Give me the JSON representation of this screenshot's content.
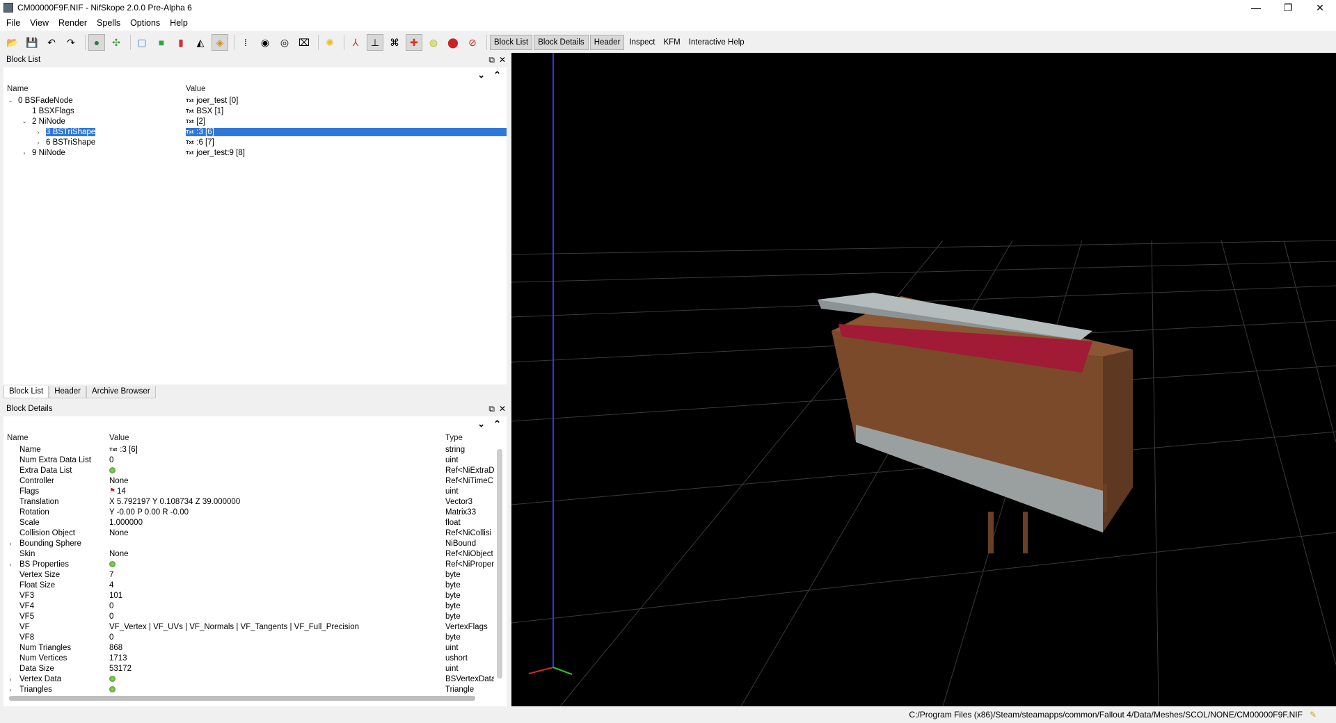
{
  "window": {
    "title": "CM00000F9F.NIF - NifSkope 2.0.0 Pre-Alpha 6",
    "controls": [
      "—",
      "❐",
      "✕"
    ]
  },
  "menu": [
    "File",
    "View",
    "Render",
    "Spells",
    "Options",
    "Help"
  ],
  "toolbar": {
    "text_buttons": [
      "Block List",
      "Block Details",
      "Header",
      "Inspect",
      "KFM",
      "Interactive Help"
    ]
  },
  "block_list": {
    "title": "Block List",
    "columns": [
      "Name",
      "Value"
    ],
    "rows": [
      {
        "name": "0 BSFadeNode",
        "value": "joer_test [0]",
        "indent": 0,
        "arrow": "v"
      },
      {
        "name": "1 BSXFlags",
        "value": "BSX [1]",
        "indent": 1,
        "arrow": ""
      },
      {
        "name": "2 NiNode",
        "value": "[2]",
        "indent": 1,
        "arrow": "v"
      },
      {
        "name": "3 BSTriShape",
        "value": ":3 [6]",
        "indent": 2,
        "arrow": ">",
        "selected": true
      },
      {
        "name": "6 BSTriShape",
        "value": ":6 [7]",
        "indent": 2,
        "arrow": ">"
      },
      {
        "name": "9 NiNode",
        "value": "joer_test:9 [8]",
        "indent": 1,
        "arrow": ">"
      }
    ],
    "tabs": [
      "Block List",
      "Header",
      "Archive Browser"
    ]
  },
  "block_details": {
    "title": "Block Details",
    "columns": [
      "Name",
      "Value",
      "Type"
    ],
    "rows": [
      {
        "name": "Name",
        "value": ":3 [6]",
        "type": "string",
        "tag": "txt"
      },
      {
        "name": "Num Extra Data List",
        "value": "0",
        "type": "uint"
      },
      {
        "name": "Extra Data List",
        "value": "",
        "type": "Ref<NiExtraD",
        "tag": "dot"
      },
      {
        "name": "Controller",
        "value": "None",
        "type": "Ref<NiTimeC"
      },
      {
        "name": "Flags",
        "value": "14",
        "type": "uint",
        "tag": "flag"
      },
      {
        "name": "Translation",
        "value": "X 5.792197 Y 0.108734 Z 39.000000",
        "type": "Vector3"
      },
      {
        "name": "Rotation",
        "value": "Y -0.00 P 0.00 R -0.00",
        "type": "Matrix33"
      },
      {
        "name": "Scale",
        "value": "1.000000",
        "type": "float"
      },
      {
        "name": "Collision Object",
        "value": "None",
        "type": "Ref<NiCollisi"
      },
      {
        "name": "Bounding Sphere",
        "value": "",
        "type": "NiBound",
        "arrow": ">"
      },
      {
        "name": "Skin",
        "value": "None",
        "type": "Ref<NiObject"
      },
      {
        "name": "BS Properties",
        "value": "",
        "type": "Ref<NiProper",
        "tag": "dot",
        "arrow": ">"
      },
      {
        "name": "Vertex Size",
        "value": "7",
        "type": "byte"
      },
      {
        "name": "Float Size",
        "value": "4",
        "type": "byte"
      },
      {
        "name": "VF3",
        "value": "101",
        "type": "byte"
      },
      {
        "name": "VF4",
        "value": "0",
        "type": "byte"
      },
      {
        "name": "VF5",
        "value": "0",
        "type": "byte"
      },
      {
        "name": "VF",
        "value": "VF_Vertex | VF_UVs | VF_Normals | VF_Tangents | VF_Full_Precision",
        "type": "VertexFlags"
      },
      {
        "name": "VF8",
        "value": "0",
        "type": "byte"
      },
      {
        "name": "Num Triangles",
        "value": "868",
        "type": "uint"
      },
      {
        "name": "Num Vertices",
        "value": "1713",
        "type": "ushort"
      },
      {
        "name": "Data Size",
        "value": "53172",
        "type": "uint"
      },
      {
        "name": "Vertex Data",
        "value": "",
        "type": "BSVertexData",
        "tag": "dot",
        "arrow": ">"
      },
      {
        "name": "Triangles",
        "value": "",
        "type": "Triangle",
        "tag": "dot",
        "arrow": ">"
      }
    ]
  },
  "status": {
    "path": "C:/Program Files (x86)/Steam/steamapps/common/Fallout 4/Data/Meshes/SCOL/NONE/CM00000F9F.NIF"
  }
}
